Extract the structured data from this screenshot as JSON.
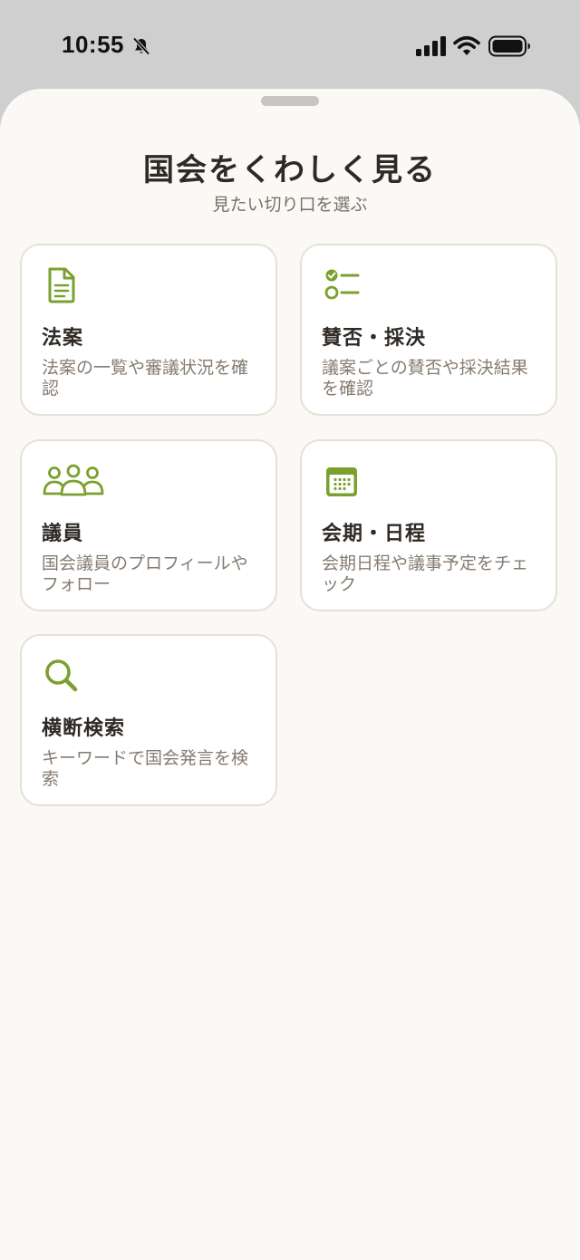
{
  "status_bar": {
    "time": "10:55",
    "icons": [
      "bell-slash-icon",
      "cellular-signal-icon",
      "wifi-icon",
      "battery-icon"
    ]
  },
  "sheet": {
    "title": "国会をくわしく見る",
    "subtitle": "見たい切り口を選ぶ"
  },
  "cards": [
    {
      "icon": "document-icon",
      "title": "法案",
      "desc": "法案の一覧や審議状況を確認"
    },
    {
      "icon": "checklist-icon",
      "title": "賛否・採決",
      "desc": "議案ごとの賛否や採決結果を確認"
    },
    {
      "icon": "people-icon",
      "title": "議員",
      "desc": "国会議員のプロフィールやフォロー"
    },
    {
      "icon": "calendar-icon",
      "title": "会期・日程",
      "desc": "会期日程や議事予定をチェック"
    },
    {
      "icon": "search-icon",
      "title": "横断検索",
      "desc": "キーワードで国会発言を検索"
    }
  ],
  "colors": {
    "accent": "#7aa12e",
    "sheet_background": "#fbf9f5",
    "title_text": "#2f2a25",
    "description_text": "#857b71",
    "card_border": "#e6e1d8"
  }
}
